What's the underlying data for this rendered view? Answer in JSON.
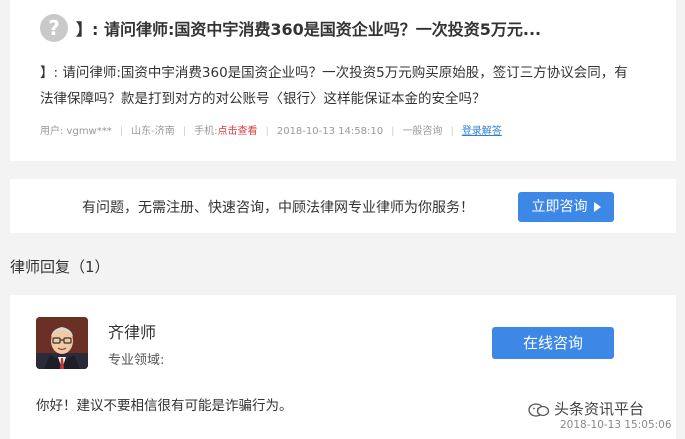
{
  "question": {
    "icon": "question-mark-icon",
    "icon_glyph": "?",
    "title": "】: 请问律师:国资中宇消费360是国资企业吗？一次投资5万元...",
    "body": "】: 请问律师:国资中宇消费360是国资企业吗？一次投资5万元购买原始股，签订三方协议会同，有法律保障吗？款是打到对方的对公账号〈银行〉这样能保证本金的安全吗？",
    "meta": {
      "user": "用户: vgmw***",
      "location": "山东-济南",
      "phone_label": "手机:",
      "phone_link": "点击查看",
      "datetime": "2018-10-13 14:58:10",
      "category": "一般咨询",
      "answer_link": "登录解答"
    }
  },
  "promo": {
    "text": "有问题，无需注册、快速咨询，中顾法律网专业律师为你服务！",
    "button": "立即咨询"
  },
  "replies_title": "律师回复（1）",
  "lawyer": {
    "name": "齐律师",
    "field_label": "专业领域:",
    "consult_button": "在线咨询",
    "reply": "你好！建议不要相信很有可能是诈骗行为。"
  },
  "watermark": {
    "text": "头条资讯平台",
    "datetime": "2018-10-13 15:05:06"
  },
  "colors": {
    "accent": "#3d87e7",
    "red_link": "#e4393c",
    "blue_link": "#2f7fd8",
    "background": "#f3f3f3"
  }
}
